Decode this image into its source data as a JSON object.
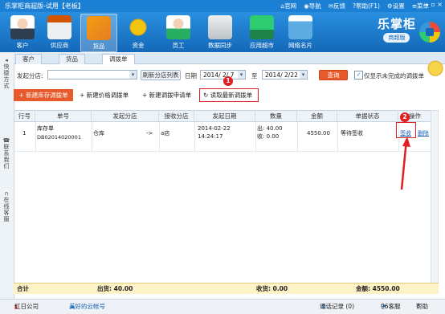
{
  "title_bar": {
    "title": "乐掌柜商超版-试用【老板】",
    "menu": [
      {
        "icon": "home-icon",
        "label": "官网"
      },
      {
        "icon": "nav-icon",
        "label": "导航"
      },
      {
        "icon": "feedback-icon",
        "label": "反馈"
      },
      {
        "icon": "help-icon",
        "label": "帮助(F1)"
      },
      {
        "icon": "gear-icon",
        "label": "设置"
      },
      {
        "icon": "menu-icon",
        "label": "菜单"
      }
    ]
  },
  "nav": [
    {
      "id": "customer",
      "label": "客户"
    },
    {
      "id": "supplier",
      "label": "供应商"
    },
    {
      "id": "goods",
      "label": "货品"
    },
    {
      "id": "funds",
      "label": "资金"
    },
    {
      "id": "staff",
      "label": "员工"
    },
    {
      "id": "sync",
      "label": "数据同步"
    },
    {
      "id": "appmarket",
      "label": "应用超市"
    },
    {
      "id": "card",
      "label": "网络名片"
    }
  ],
  "brand": {
    "name": "乐掌柜",
    "edition": "商超版"
  },
  "rail": [
    {
      "label": "快捷方式"
    },
    {
      "label": "联系我们"
    },
    {
      "label": "在线客服"
    }
  ],
  "tabs": [
    {
      "label": "客户"
    },
    {
      "label": "货品"
    },
    {
      "label": "调拨单"
    }
  ],
  "filter": {
    "branch_label": "发起分店:",
    "branch_value": "",
    "refresh_label": "刷新分店列表",
    "date_label": "日期",
    "date_from": "2014/ 2/ 7",
    "to_label": "至",
    "date_to": "2014/ 2/22",
    "query_label": "查询",
    "only_incomplete_label": "仅显示未完成的调拨单",
    "only_incomplete_checked": true
  },
  "actions": {
    "new_stock": "+ 新建库存调拨单",
    "new_price": "+ 新建价格调拨单",
    "new_request": "+ 新建调拨申请单",
    "read_latest": "读取最新调拨单"
  },
  "table": {
    "headers": [
      "行号",
      "单号",
      "发起分店",
      "接收分店",
      "发起日期",
      "数量",
      "金额",
      "单据状态",
      "操作"
    ],
    "rows": [
      {
        "row_no": "1",
        "doc_type": "库存单",
        "doc_no": "DB02014020001",
        "from_branch": "仓库",
        "arrow": "->",
        "to_branch": "a店",
        "date": "2014-02-22",
        "time": "14:24:17",
        "out_qty": "出: 40.00",
        "in_qty": "收: 0.00",
        "amount": "4550.00",
        "status": "等待签收",
        "op_sign": "签收",
        "op_delete": "删除"
      }
    ]
  },
  "totals": {
    "label": "合计",
    "out": "出货: 40.00",
    "in": "收货: 0.00",
    "amount": "金额: 4550.00"
  },
  "status_bar": {
    "company": "红日公司",
    "cloud": "美好的云帐号",
    "call_log": "通话记录 (0)",
    "support": "96客服",
    "help": "帮助"
  },
  "annotations": [
    "1",
    "2"
  ],
  "colors": {
    "accent": "#1b7fd3",
    "action_orange": "#e8592b",
    "annotation_red": "#e02020",
    "total_bg": "#fdf3c6"
  }
}
